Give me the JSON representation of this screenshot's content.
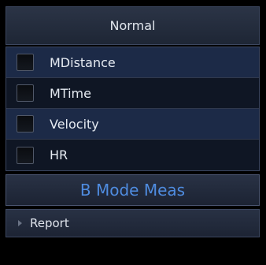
{
  "header": {
    "title": "Normal"
  },
  "measurements": [
    {
      "label": "MDistance",
      "checked": false
    },
    {
      "label": "MTime",
      "checked": false
    },
    {
      "label": "Velocity",
      "checked": false
    },
    {
      "label": "HR",
      "checked": false
    }
  ],
  "mode_button": {
    "label": "B Mode Meas"
  },
  "report": {
    "label": "Report",
    "icon": "triangle-right-icon"
  },
  "colors": {
    "accent": "#4f8ce0",
    "row_highlight": "#1c2a47",
    "row_dark": "#0f1624"
  }
}
